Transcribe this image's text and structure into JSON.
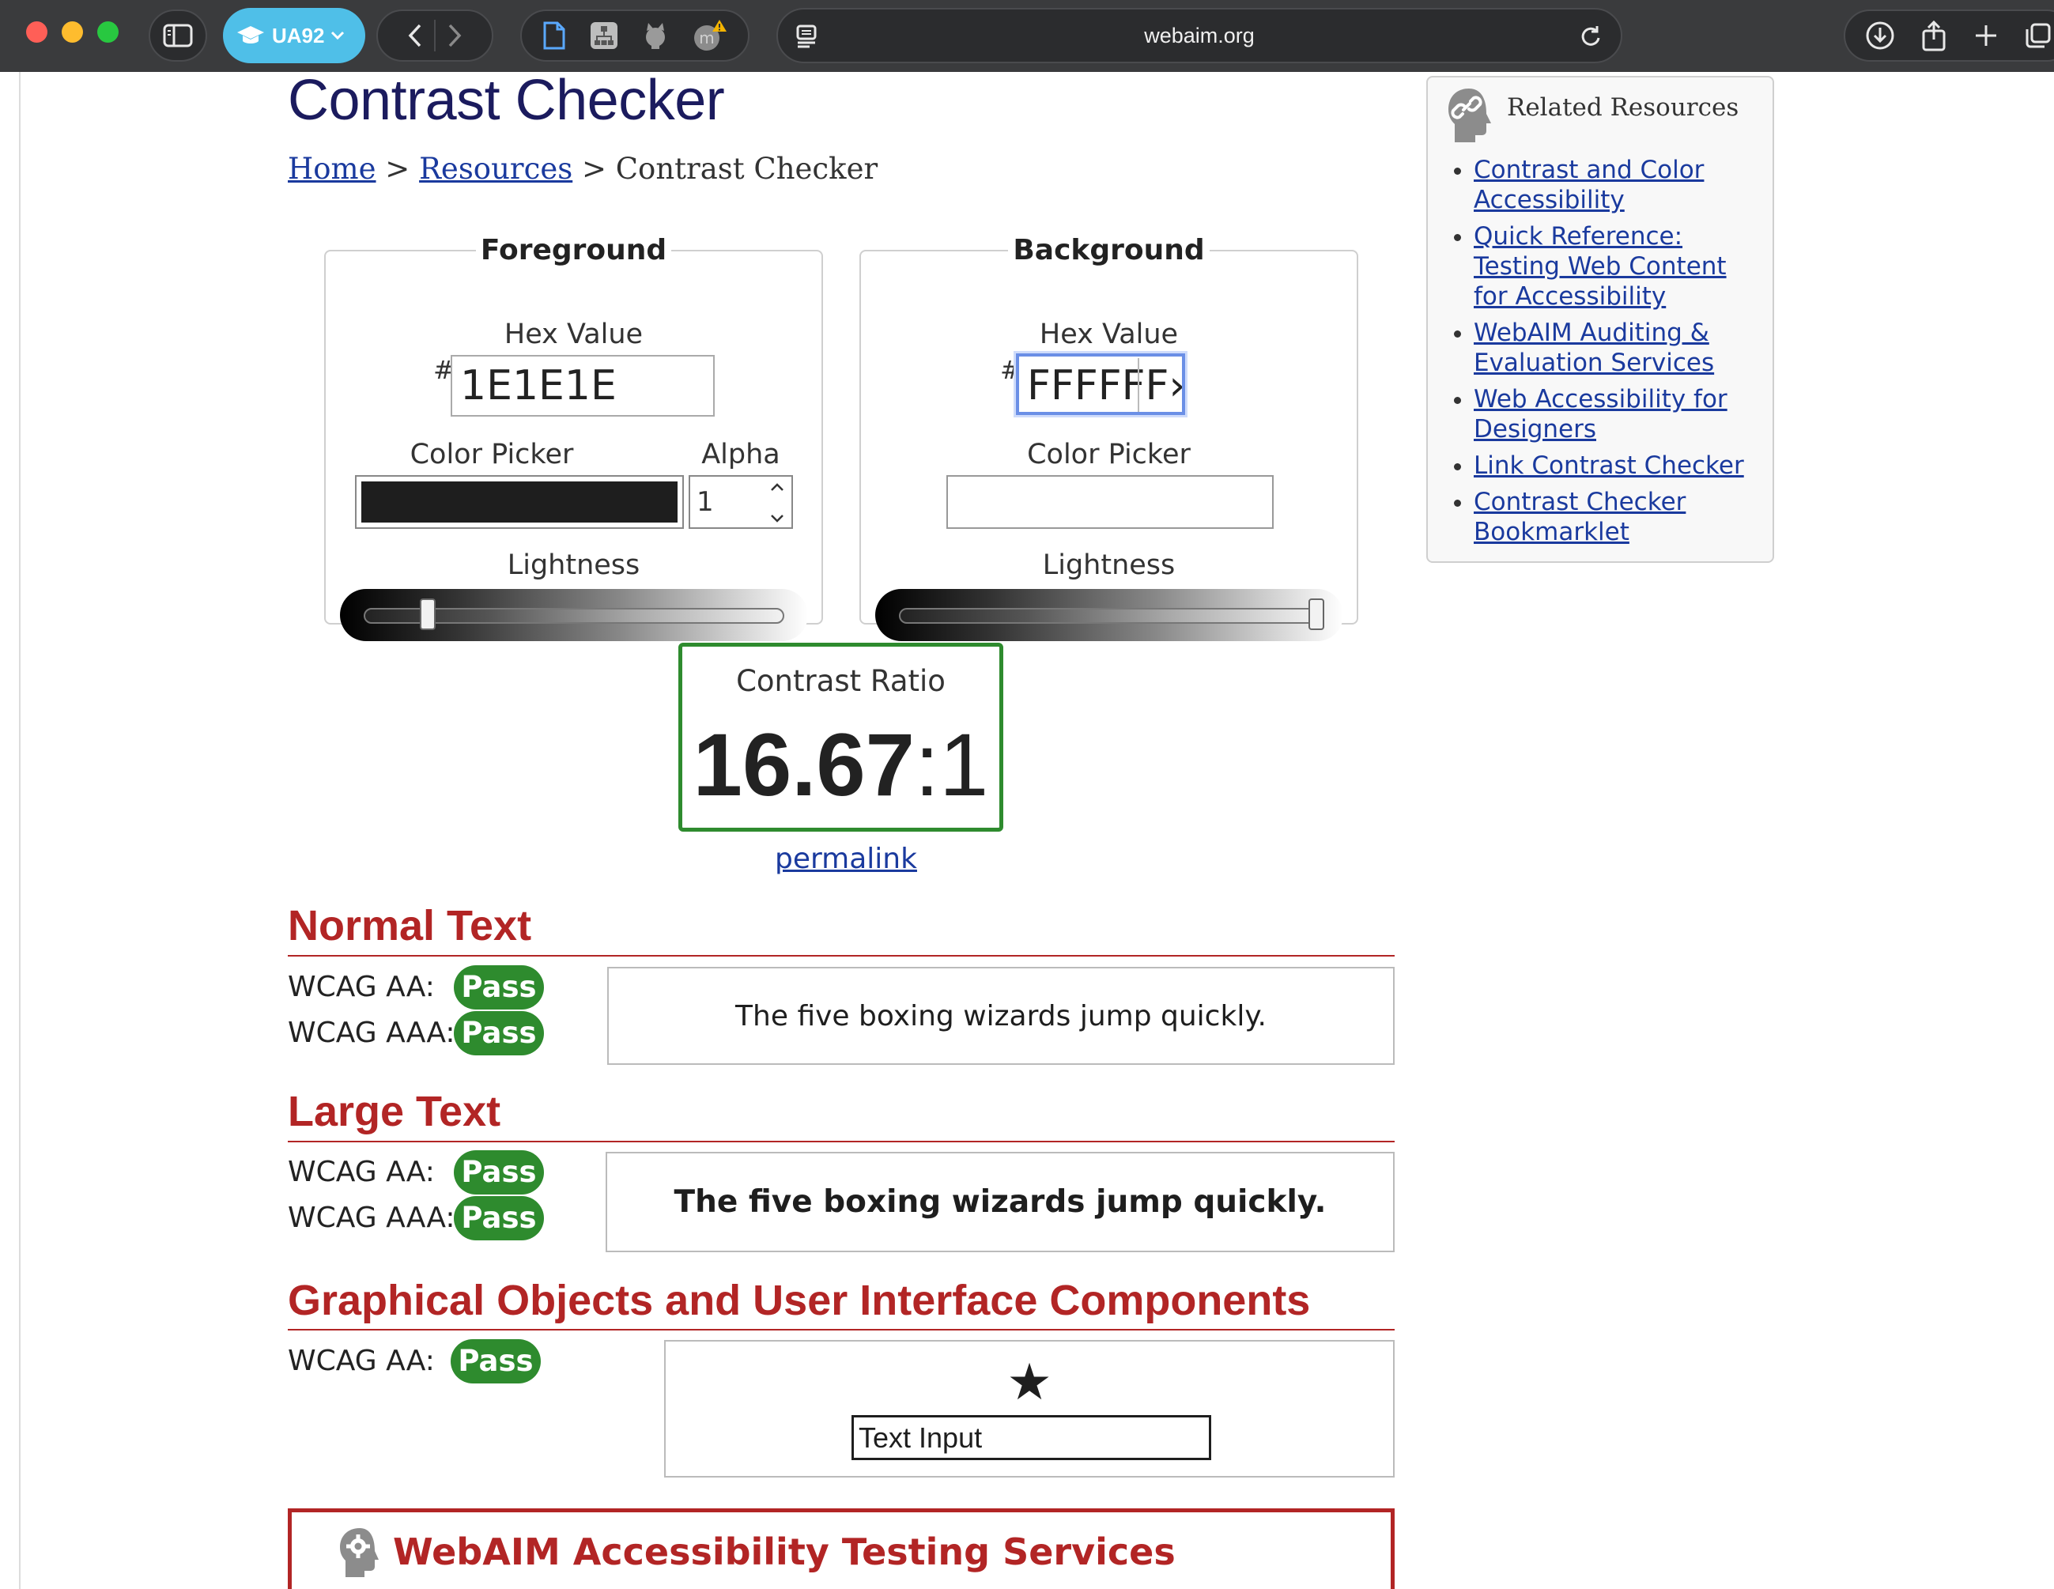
{
  "browser": {
    "profile_label": "UA92",
    "url": "webaim.org"
  },
  "page": {
    "title": "Contrast Checker",
    "breadcrumb": {
      "home": "Home",
      "sep1": " > ",
      "resources": "Resources",
      "sep2": " > ",
      "current": "Contrast Checker"
    }
  },
  "foreground": {
    "legend": "Foreground",
    "hex_label": "Hex Value",
    "hash": "#",
    "hex_value": "1E1E1E",
    "color_picker_label": "Color Picker",
    "alpha_label": "Alpha",
    "alpha_value": "1",
    "lightness_label": "Lightness",
    "lightness_level": 0.12,
    "color": "#1e1e1e"
  },
  "background": {
    "legend": "Background",
    "hex_label": "Hex Value",
    "hash": "#",
    "hex_value": "FFFFFF›",
    "color_picker_label": "Color Picker",
    "lightness_label": "Lightness",
    "lightness_level": 1.0,
    "color": "#ffffff"
  },
  "contrast": {
    "label": "Contrast Ratio",
    "ratio_main": "16.67",
    "ratio_sep": ":1",
    "permalink": "permalink"
  },
  "sections": {
    "normal": {
      "heading": "Normal Text",
      "aa_label": "WCAG AA:",
      "aa_result": "Pass",
      "aaa_label": "WCAG AAA:",
      "aaa_result": "Pass",
      "sample": "The five boxing wizards jump quickly."
    },
    "large": {
      "heading": "Large Text",
      "aa_label": "WCAG AA:",
      "aa_result": "Pass",
      "aaa_label": "WCAG AAA:",
      "aaa_result": "Pass",
      "sample": "The five boxing wizards jump quickly."
    },
    "graphical": {
      "heading": "Graphical Objects and User Interface Components",
      "aa_label": "WCAG AA:",
      "aa_result": "Pass",
      "star": "★",
      "text_input": "Text Input"
    }
  },
  "services": {
    "title": "WebAIM Accessibility Testing Services",
    "icon": "gear-head-icon"
  },
  "related": {
    "title": "Related Resources",
    "icon": "link-head-icon",
    "links": [
      "Contrast and Color Accessibility",
      "Quick Reference: Testing Web Content for Accessibility",
      "WebAIM Auditing & Evaluation Services",
      "Web Accessibility for Designers",
      "Link Contrast Checker",
      "Contrast Checker Bookmarklet"
    ]
  },
  "colors": {
    "pass": "#2e8b2e",
    "heading_red": "#b22525",
    "title_navy": "#1b1b5e",
    "link_blue": "#1a3a9e"
  }
}
